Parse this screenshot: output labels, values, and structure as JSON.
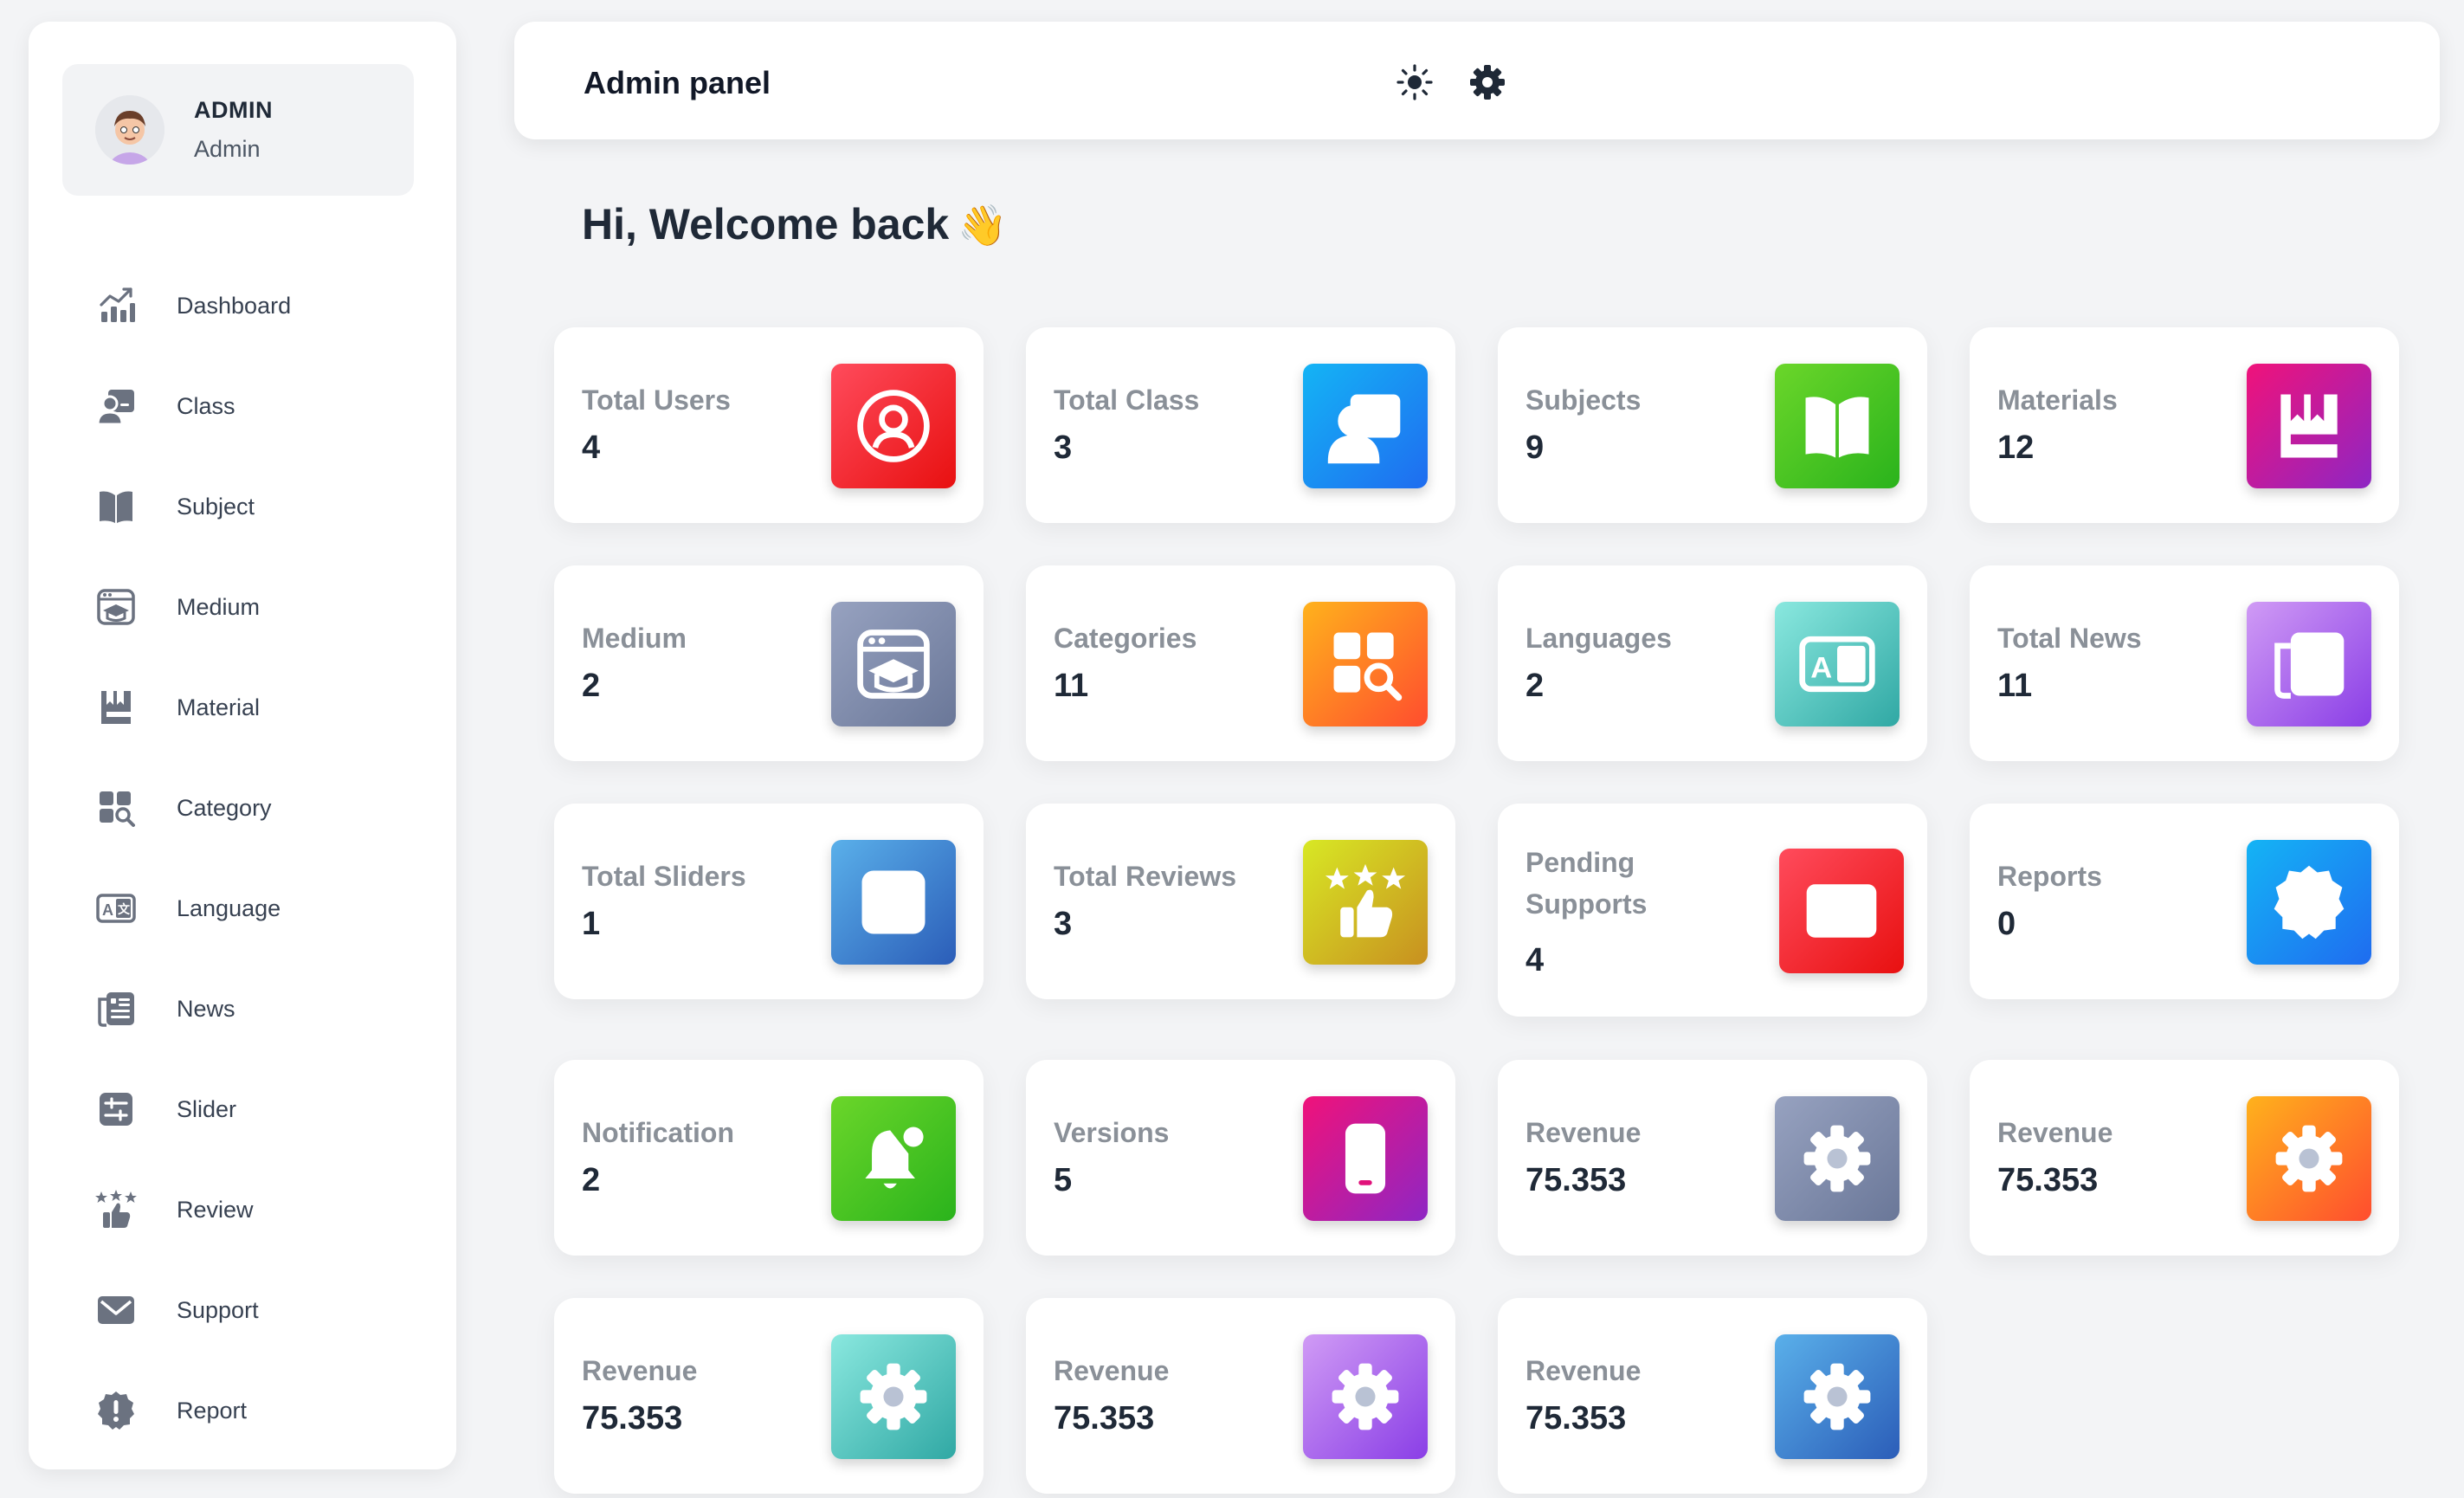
{
  "user": {
    "name": "ADMIN",
    "role": "Admin"
  },
  "sidebar": {
    "items": [
      {
        "label": "Dashboard",
        "icon": "chart-icon"
      },
      {
        "label": "Class",
        "icon": "class-icon"
      },
      {
        "label": "Subject",
        "icon": "book-icon"
      },
      {
        "label": "Medium",
        "icon": "medium-icon"
      },
      {
        "label": "Material",
        "icon": "material-icon"
      },
      {
        "label": "Category",
        "icon": "category-icon"
      },
      {
        "label": "Language",
        "icon": "language-icon"
      },
      {
        "label": "News",
        "icon": "news-icon"
      },
      {
        "label": "Slider",
        "icon": "slider-icon"
      },
      {
        "label": "Review",
        "icon": "review-icon"
      },
      {
        "label": "Support",
        "icon": "mail-icon"
      },
      {
        "label": "Report",
        "icon": "report-icon"
      }
    ]
  },
  "header": {
    "title": "Admin panel"
  },
  "welcome": {
    "text": "Hi, Welcome back",
    "emoji": "👋"
  },
  "cards": [
    {
      "label": "Total Users",
      "value": "4",
      "icon": "user-icon",
      "colors": [
        "#ff4b5c",
        "#e81010"
      ]
    },
    {
      "label": "Total Class",
      "value": "3",
      "icon": "class-icon",
      "colors": [
        "#14b4f5",
        "#1f6cf0"
      ]
    },
    {
      "label": "Subjects",
      "value": "9",
      "icon": "book-icon",
      "colors": [
        "#6bd62a",
        "#2ab31c"
      ]
    },
    {
      "label": "Materials",
      "value": "12",
      "icon": "material-icon",
      "colors": [
        "#f0127a",
        "#8e26c4"
      ]
    },
    {
      "label": "Medium",
      "value": "2",
      "icon": "medium-icon",
      "colors": [
        "#97a2c0",
        "#6a7798"
      ]
    },
    {
      "label": "Categories",
      "value": "11",
      "icon": "category-icon",
      "colors": [
        "#ffb21c",
        "#ff4d2e"
      ]
    },
    {
      "label": "Languages",
      "value": "2",
      "icon": "language-icon",
      "colors": [
        "#8ae8df",
        "#30a8a4"
      ]
    },
    {
      "label": "Total News",
      "value": "11",
      "icon": "news-icon",
      "colors": [
        "#d09bf5",
        "#8a3ee6"
      ]
    },
    {
      "label": "Total Sliders",
      "value": "1",
      "icon": "slider-icon",
      "colors": [
        "#5ab0ea",
        "#2b5db8"
      ]
    },
    {
      "label": "Total Reviews",
      "value": "3",
      "icon": "review-icon",
      "colors": [
        "#d8e824",
        "#c89020"
      ]
    },
    {
      "label": "Pending Supports",
      "value": "4",
      "icon": "mail-icon",
      "colors": [
        "#ff4b5c",
        "#e81010"
      ]
    },
    {
      "label": "Reports",
      "value": "0",
      "icon": "report-icon",
      "colors": [
        "#14b4f5",
        "#1f6cf0"
      ]
    },
    {
      "label": "Notification",
      "value": "2",
      "icon": "bell-icon",
      "colors": [
        "#6bd62a",
        "#2ab31c"
      ]
    },
    {
      "label": "Versions",
      "value": "5",
      "icon": "phone-icon",
      "colors": [
        "#f0127a",
        "#8e26c4"
      ]
    },
    {
      "label": "Revenue",
      "value": "75.353",
      "icon": "gear-icon",
      "colors": [
        "#97a2c0",
        "#6a7798"
      ]
    },
    {
      "label": "Revenue",
      "value": "75.353",
      "icon": "gear-icon",
      "colors": [
        "#ffb21c",
        "#ff4d2e"
      ]
    },
    {
      "label": "Revenue",
      "value": "75.353",
      "icon": "gear-icon",
      "colors": [
        "#8ae8df",
        "#30a8a4"
      ]
    },
    {
      "label": "Revenue",
      "value": "75.353",
      "icon": "gear-icon",
      "colors": [
        "#d09bf5",
        "#8a3ee6"
      ]
    },
    {
      "label": "Revenue",
      "value": "75.353",
      "icon": "gear-icon",
      "colors": [
        "#5ab0ea",
        "#2b5db8"
      ]
    }
  ]
}
